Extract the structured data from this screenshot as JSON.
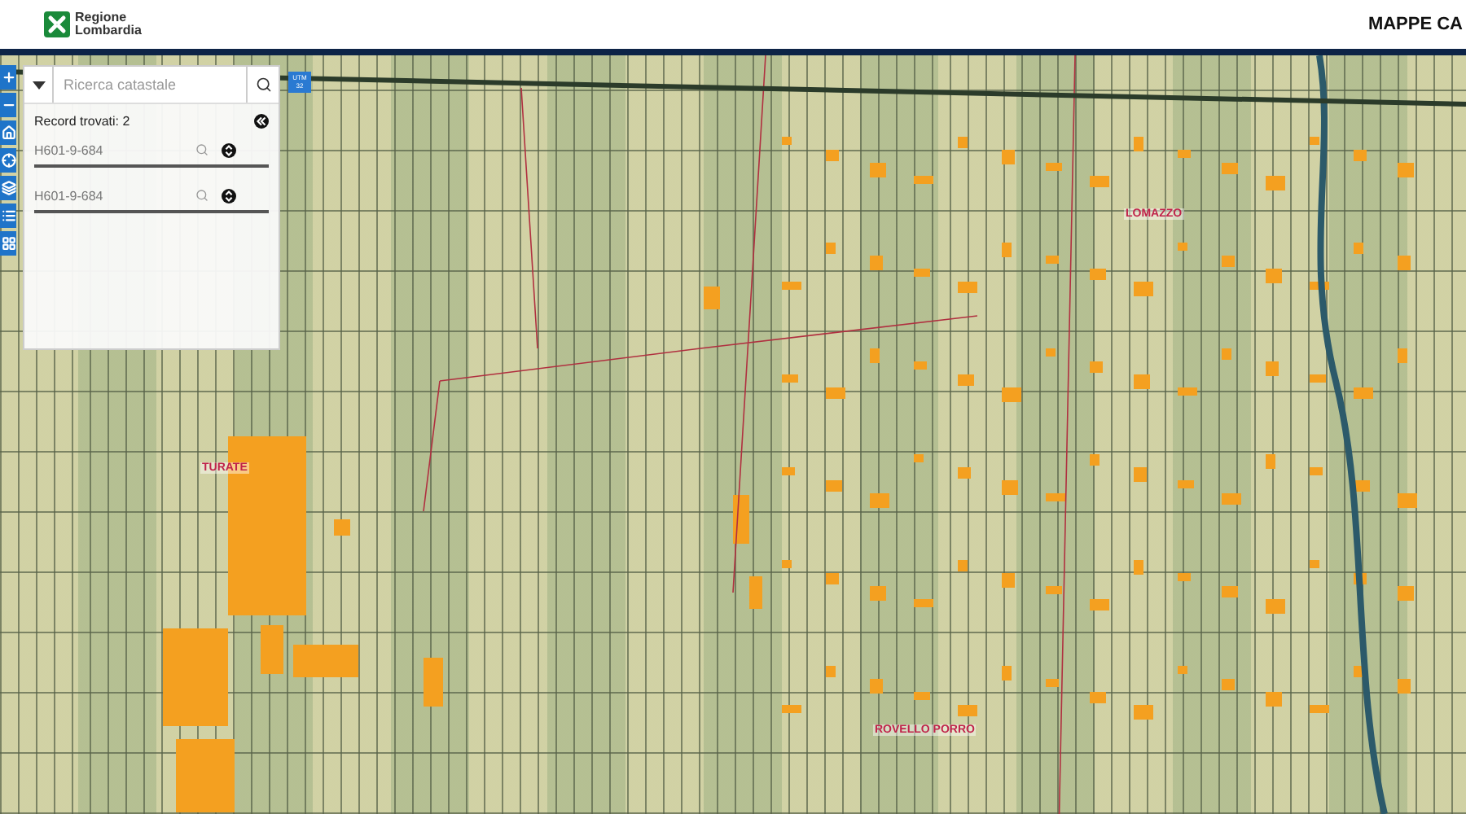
{
  "header": {
    "logo_text": "Regione Lombardia",
    "title": "MAPPE CA"
  },
  "search": {
    "placeholder": "Ricerca catastale"
  },
  "utm_badge": "UTM 32",
  "results": {
    "summary": "Record trovati: 2",
    "items": [
      {
        "code": "H601-9-684"
      },
      {
        "code": "H601-9-684"
      }
    ]
  },
  "map_labels": [
    "LOMAZZO",
    "TURATE",
    "ROVELLO PORRO"
  ]
}
